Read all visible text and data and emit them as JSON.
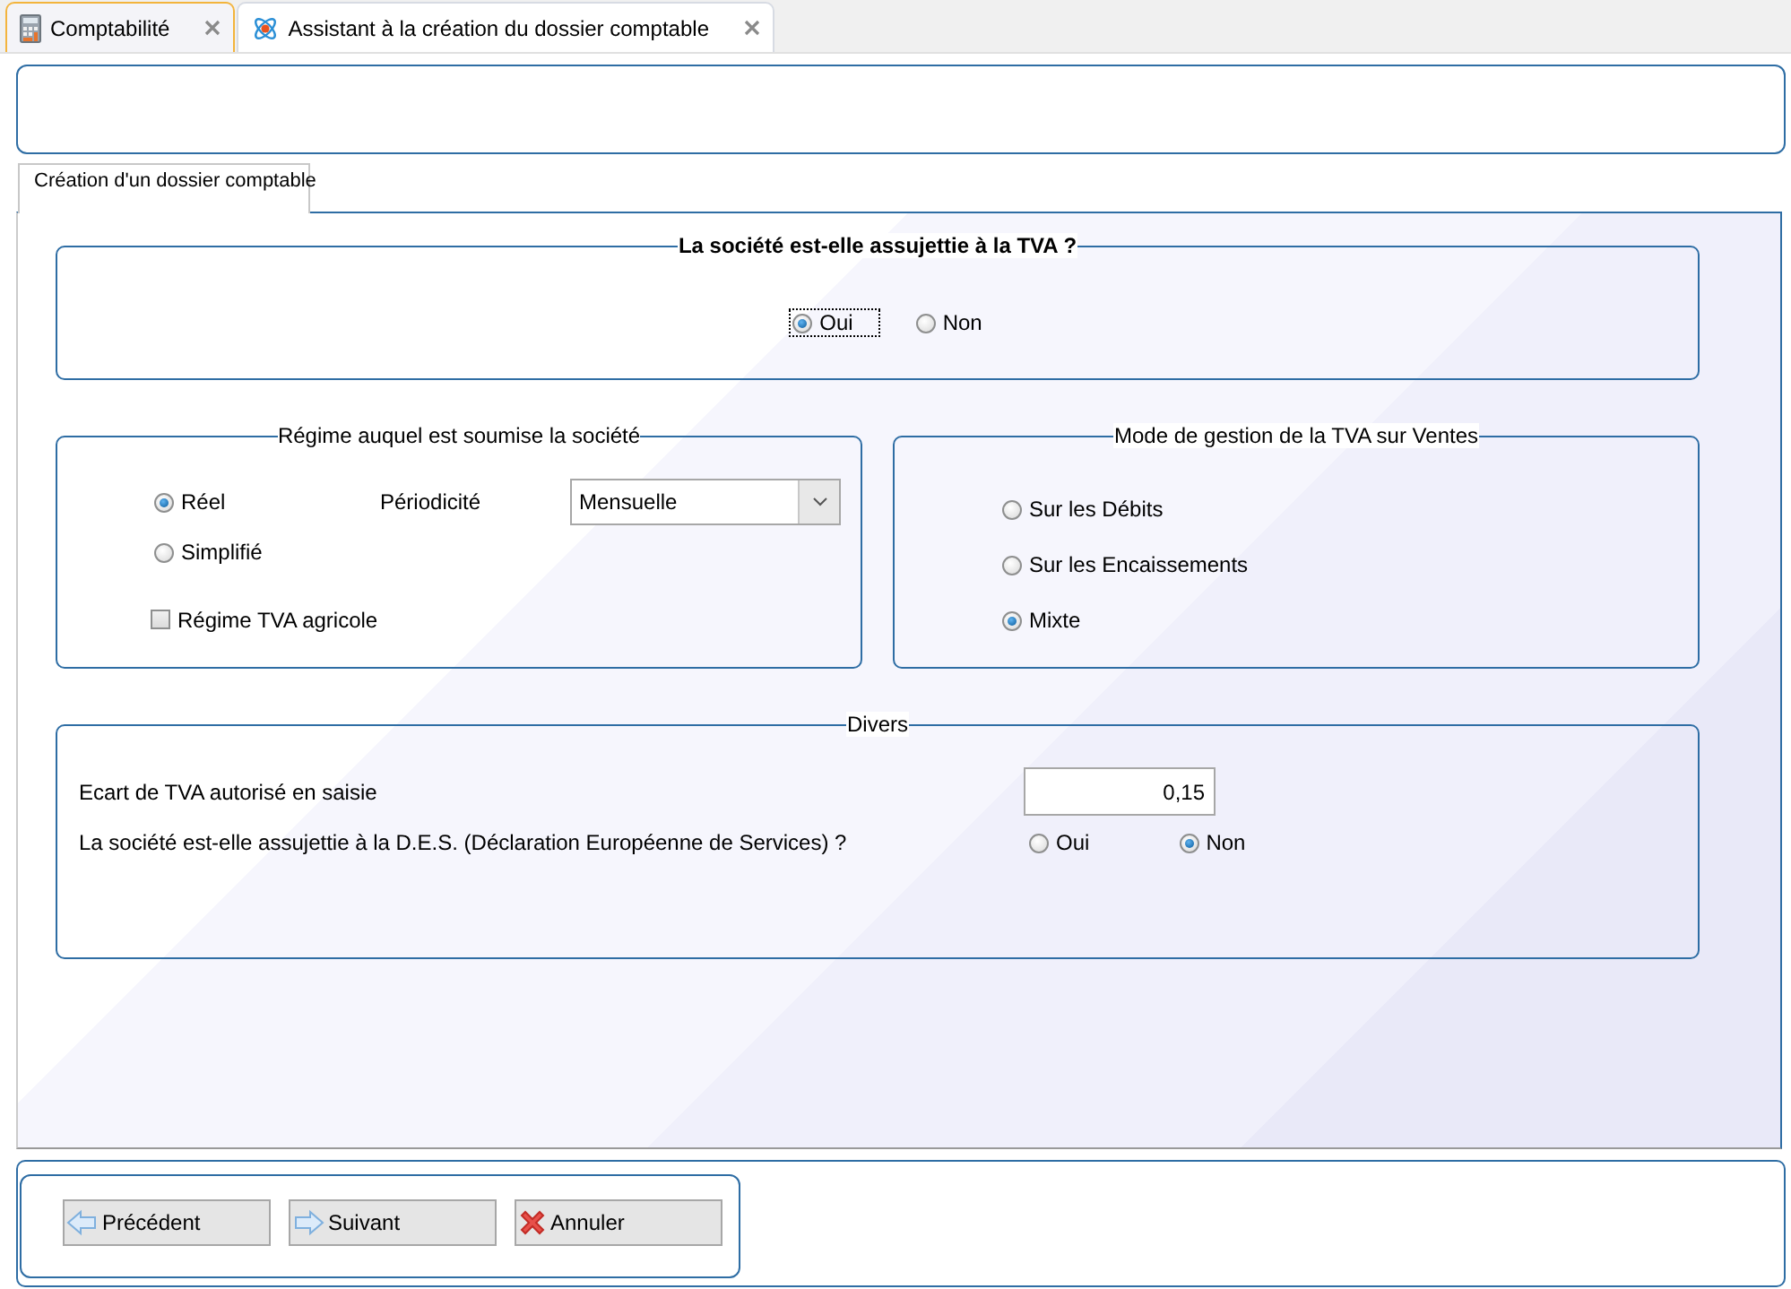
{
  "tabs": [
    {
      "label": "Comptabilité",
      "selected": false,
      "kind": "calculator"
    },
    {
      "label": "Assistant à la création du dossier comptable",
      "selected": true,
      "kind": "atom"
    }
  ],
  "page_tab": {
    "label": "Création d'un dossier comptable",
    "selected": true
  },
  "tva_group": {
    "title": "La société est-elle assujettie à la TVA ?",
    "options": [
      {
        "label": "Oui",
        "selected": true,
        "focused": true
      },
      {
        "label": "Non",
        "selected": false,
        "focused": false
      }
    ]
  },
  "regime_group": {
    "title": "Régime auquel est soumise la société",
    "options": [
      {
        "label": "Réel",
        "selected": true
      },
      {
        "label": "Simplifié",
        "selected": false
      }
    ],
    "periodicity_label": "Périodicité",
    "periodicity_value": "Mensuelle",
    "agricultural": {
      "label": "Régime TVA agricole",
      "checked": false
    }
  },
  "mode_group": {
    "title": "Mode de gestion de la TVA sur Ventes",
    "options": [
      {
        "label": "Sur les Débits",
        "selected": false
      },
      {
        "label": "Sur les Encaissements",
        "selected": false
      },
      {
        "label": "Mixte",
        "selected": true
      }
    ]
  },
  "divers_group": {
    "title": "Divers",
    "tolerance_label": "Ecart de TVA autorisé en saisie",
    "tolerance_value": "0,15",
    "des_label": "La société est-elle assujettie à la D.E.S. (Déclaration Européenne de Services) ?",
    "des_options": [
      {
        "label": "Oui",
        "selected": false
      },
      {
        "label": "Non",
        "selected": true
      }
    ]
  },
  "buttons": [
    {
      "label": "Précédent",
      "kind": "back"
    },
    {
      "label": "Suivant",
      "kind": "next"
    },
    {
      "label": "Annuler",
      "kind": "cancel"
    }
  ]
}
